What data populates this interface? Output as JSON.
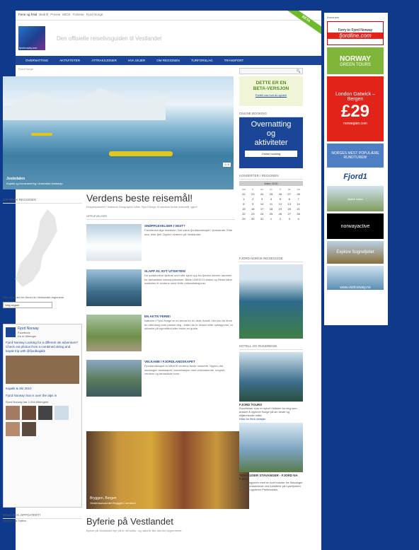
{
  "topbar": {
    "items": [
      "Ferie og fritid",
      "Bedrift",
      "Presse",
      "MICE",
      "Turisme",
      "Fjord Norge"
    ]
  },
  "beta_ribbon": "BETA",
  "logo_text": "fjordnorway.com",
  "tagline": "Den offisielle reiselivsguiden til Vestlandet",
  "nav": [
    "OVERNATTING",
    "AKTIVITETER",
    "ATTRAKSJONER",
    "HVA SKJER",
    "OM REGIONEN",
    "TURFORSLAG",
    "TRANSPORT"
  ],
  "breadcrumb": "Fjord Norge",
  "hero": {
    "caption": "Jostedalen",
    "subcaption": "Kajakk og breavandring i dramatisk landskap",
    "pager": "1 / 5"
  },
  "beta_box": {
    "title_1": "DETTE ER EN",
    "title_2": "BETA-VERSJON",
    "link": "Fortell oss hva du synes!"
  },
  "booking": {
    "section": "ONLINE BOOKING",
    "title_1": "Overnatting",
    "title_2": "og",
    "title_3": "aktiviteter",
    "button": "Online booking"
  },
  "calendar": {
    "section": "KONSERTER I REGIONEN",
    "month": "Mars 2010",
    "days": [
      "ma",
      "ti",
      "on",
      "to",
      "fr",
      "lø",
      "sø"
    ],
    "dates": [
      "22",
      "23",
      "24",
      "25",
      "26",
      "27",
      "28",
      "1",
      "2",
      "3",
      "4",
      "5",
      "6",
      "7",
      "8",
      "9",
      "10",
      "11",
      "12",
      "13",
      "14",
      "15",
      "16",
      "17",
      "18",
      "19",
      "20",
      "21",
      "22",
      "23",
      "24",
      "25",
      "26",
      "27",
      "28",
      "29",
      "30",
      "31",
      "1",
      "2",
      "3",
      "4"
    ]
  },
  "left": {
    "section": "UTFORSK REGIONEN",
    "map_note": "Ikke på kartet her finner du Vestlandet regionene",
    "select": "Velg region"
  },
  "facebook": {
    "name": "Fjord Norway",
    "sub": "Facebook",
    "like": "Du er tilhenger",
    "post1": "Fjord Norway Looking for a different ski adventure? Check out photos from a combined skiing and kayak trip with @fjordkajakk",
    "post1_link": "Kajakk & Ski 2010",
    "post2": "Fjord Norway Sun is over the alps in",
    "fans": "Fjord Norway har 1,254 tilhengere",
    "twitter_section": "HOLD DEG OPPDATERT!",
    "twitter_sub": "Nyheter via Twitter"
  },
  "main": {
    "title": "Verdens beste reisemål!",
    "lead": "Ekspertpanelet i National Geographic kårer Fjord Norge til verdens beste reisemål, igjen!",
    "section": "OPPLEVELSER"
  },
  "experiences": [
    {
      "title": "SNØPPLEVELSER I VEST?",
      "text": "Familievennlige skisteder, Det vakre fjordlandskapet i vinterdrakt. Ekte snø, ekte fjell. Opplev vinteren på Vestlandet."
    },
    {
      "title": "SLAPP AV, NYT UTSIKTEN!",
      "text": "De solskinnene fjellene som ofte kjent opp fra fjorden danner rammen for fantastiske naturopplevelser. Både UNESCO-status og Reise kårer nøkkelen til verdens mest flotte naturattraksjoner."
    },
    {
      "title": "EN AKTIV FERIE!",
      "text": "Naturen i Fjord Norge er en arena for en aktiv livsstil. Her kan du finne en utfordring som passer deg - enten du er skiport eller nybegynner, et utforske på egenhånd eller bruke en guide."
    },
    {
      "title": "VELKAME I FJORDLANDSKAPET",
      "text": "Fjordlandskapet er kåret til verdens beste reisemål. Opplev det storslagne landskapet i kombinasjon med velsmakende, ivrighet, verdens og fantastiske turer."
    }
  ],
  "bryggen": {
    "caption": "Bryggen, Bergen",
    "sub": "Verdensarvstedet Bryggen i sentrum"
  },
  "byferie": {
    "title": "Byferie på Vestlandet",
    "sub": "Byene på Vestlandet byr på et rikt kultur- og naturliv like utenfor bygrensene."
  },
  "side2": {
    "section": "FJORD NORGE REISEGUIDE",
    "hotell": "HOTELL OG RUNDREISE",
    "fjord_tours": "FJORD TOURS",
    "fjord_tours_text": "Rundreiser som er nyhet i blikken for deg som ønsker å oppleve Norge på sin beste og eiljævnende måte.",
    "link": "Klikk for flere detaljer",
    "cruise": "TIDE RUSER STAVANGER - FJORD NA FJELL",
    "cruise_text": "Turen begynner med en kort busstur fra Stavanger til Lysefjordsenteret ved turistferie på Lysefjorden der man opplever Preikestolen."
  },
  "ads": {
    "label": "Annonser",
    "ad1": "Ferry to Fjord Norway",
    "ad1b": "fjordline.com",
    "ad2": "NORWAY",
    "ad2b": "GREEN TOURS",
    "ad3a": "London Gatwick –",
    "ad3b": "Bergen",
    "ad3c": "£29",
    "ad3d": "norwegian.com",
    "ad4": "NORGES MEST POPULÆRE RUNDTUREN!",
    "ad5": "Fjord1",
    "ad5b": "Aktive reiser",
    "ad6": "norwayactive",
    "ad7": "Explore Sognefjellet",
    "ad8": "www.visitnorway.no"
  },
  "colors": {
    "navy": "#1b4597",
    "green": "#6fba2c",
    "bg": "#0f3a8c",
    "red": "#e2231a"
  }
}
